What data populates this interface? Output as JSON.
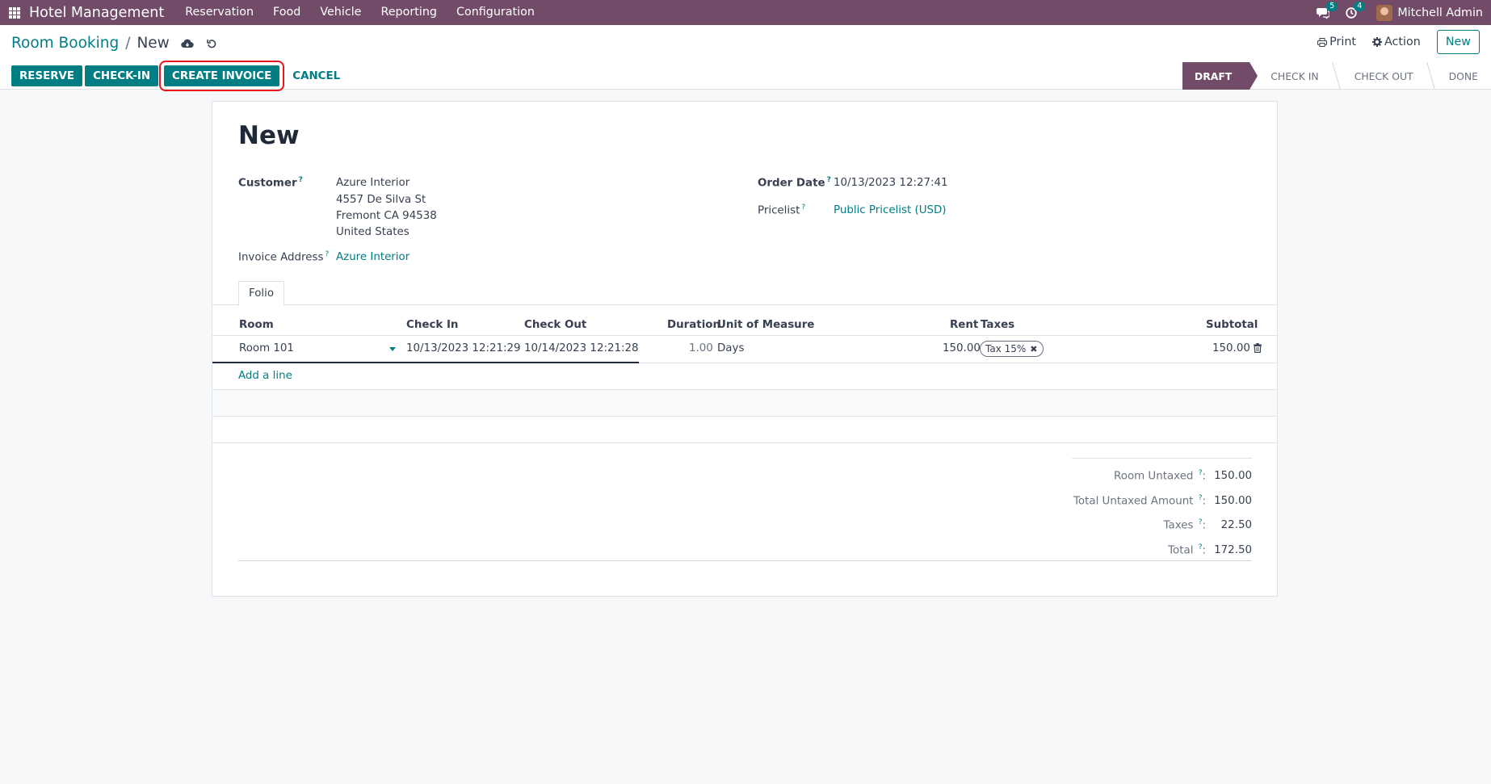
{
  "navbar": {
    "app_name": "Hotel Management",
    "menu": [
      "Reservation",
      "Food",
      "Vehicle",
      "Reporting",
      "Configuration"
    ],
    "messages_count": "5",
    "activities_count": "4",
    "user_name": "Mitchell Admin"
  },
  "breadcrumb": {
    "parent": "Room Booking",
    "separator": "/",
    "current": "New"
  },
  "toolbar": {
    "print_label": "Print",
    "action_label": "Action",
    "new_label": "New"
  },
  "status_buttons": {
    "reserve": "RESERVE",
    "checkin": "CHECK-IN",
    "create_invoice": "CREATE INVOICE",
    "cancel": "CANCEL"
  },
  "pipeline": {
    "stages": [
      "DRAFT",
      "CHECK IN",
      "CHECK OUT",
      "DONE"
    ],
    "active": "DRAFT"
  },
  "form": {
    "title": "New",
    "customer_label": "Customer",
    "customer_name": "Azure Interior",
    "customer_street": "4557 De Silva St",
    "customer_city": "Fremont CA 94538",
    "customer_country": "United States",
    "invoice_address_label": "Invoice Address",
    "invoice_address": "Azure Interior",
    "order_date_label": "Order Date",
    "order_date": "10/13/2023 12:27:41",
    "pricelist_label": "Pricelist",
    "pricelist": "Public Pricelist (USD)",
    "help_mark": "?"
  },
  "tabs": [
    "Folio"
  ],
  "table": {
    "columns": {
      "room": "Room",
      "check_in": "Check In",
      "check_out": "Check Out",
      "duration": "Duration",
      "uom": "Unit of Measure",
      "rent": "Rent",
      "taxes": "Taxes",
      "subtotal": "Subtotal"
    },
    "rows": [
      {
        "room": "Room 101",
        "check_in": "10/13/2023 12:21:29",
        "check_out": "10/14/2023 12:21:28",
        "duration": "1.00",
        "uom": "Days",
        "rent": "150.00",
        "tax": "Tax 15%",
        "subtotal": "150.00"
      }
    ],
    "add_line": "Add a line"
  },
  "totals": {
    "room_untaxed_label": "Room Untaxed",
    "room_untaxed": "150.00",
    "total_untaxed_label": "Total Untaxed Amount",
    "total_untaxed": "150.00",
    "taxes_label": "Taxes",
    "taxes": "22.50",
    "total_label": "Total",
    "total": "172.50",
    "colon": ":"
  },
  "colors": {
    "navbar": "#714b67",
    "primary": "#017e84",
    "highlight": "#e5171c"
  }
}
